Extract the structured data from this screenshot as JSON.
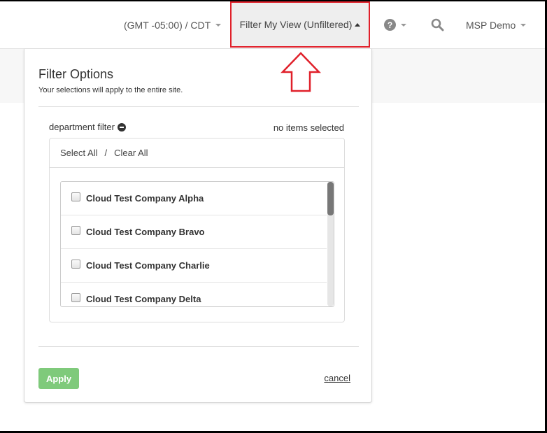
{
  "header": {
    "timezone_label": "(GMT -05:00) / CDT",
    "filter_label": "Filter My View (Unfiltered)",
    "help_icon": "question-circle-icon",
    "search_icon": "search-icon",
    "user_label": "MSP Demo"
  },
  "panel": {
    "title": "Filter Options",
    "subtitle": "Your selections will apply to the entire site.",
    "filter_name": "department filter",
    "filter_status": "no items selected",
    "select_all": "Select All",
    "separator": "/",
    "clear_all": "Clear All",
    "items": [
      {
        "label": "Cloud Test Company Alpha",
        "checked": false
      },
      {
        "label": "Cloud Test Company Bravo",
        "checked": false
      },
      {
        "label": "Cloud Test Company Charlie",
        "checked": false
      },
      {
        "label": "Cloud Test Company Delta",
        "checked": false
      }
    ],
    "apply_label": "Apply",
    "cancel_label": "cancel"
  },
  "annotation": {
    "highlight_color": "#e0202a",
    "arrow_direction": "up"
  },
  "colors": {
    "apply_button": "#7fca7b",
    "active_nav_bg": "#eeeeee"
  }
}
